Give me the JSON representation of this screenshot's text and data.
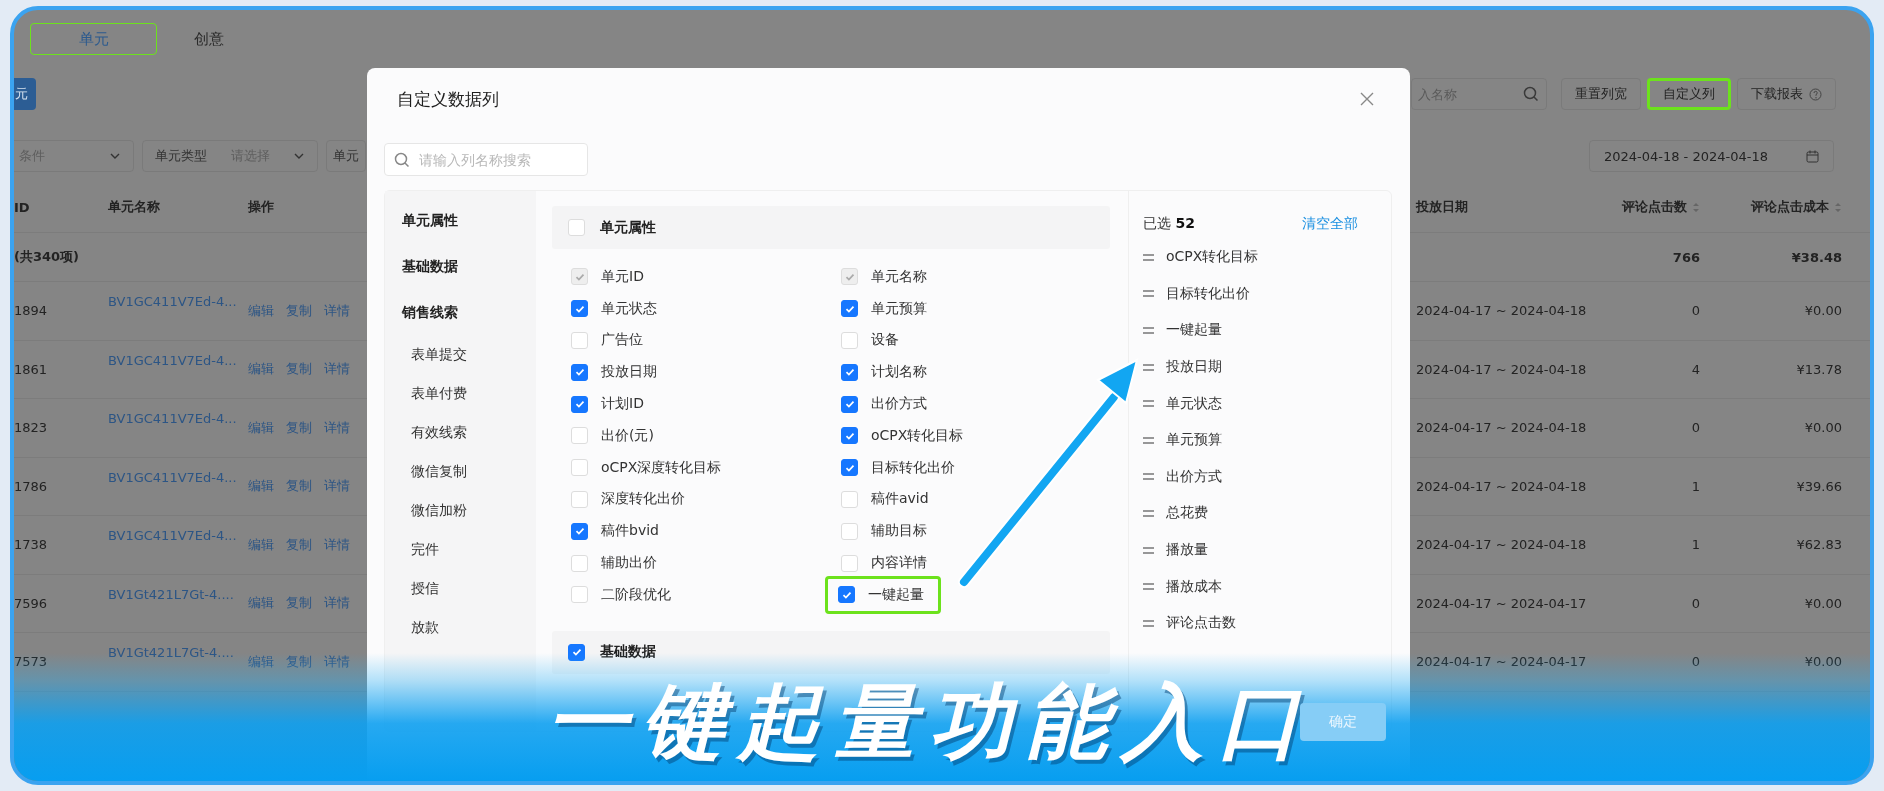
{
  "tabs": [
    {
      "label": "单元",
      "selected": true,
      "highlighted": true
    },
    {
      "label": "创意",
      "selected": false,
      "highlighted": false
    }
  ],
  "create_button": {
    "label": "元"
  },
  "search": {
    "placeholder": "入名称"
  },
  "toolbar_buttons": [
    {
      "label": "重置列宽",
      "kind": "plain",
      "highlighted": false
    },
    {
      "label": "自定义列",
      "kind": "plain",
      "highlighted": true
    },
    {
      "label": "下载报表",
      "kind": "help",
      "highlighted": false
    }
  ],
  "filters": [
    {
      "placeholder": "条件"
    },
    {
      "label": "单元类型",
      "placeholder": "请选择"
    },
    {
      "label": "单元"
    }
  ],
  "date_range": {
    "value": "2024-04-18 - 2024-04-18"
  },
  "table": {
    "columns": [
      {
        "label": "ID",
        "sortable": false
      },
      {
        "label": "单元名称",
        "sortable": false
      },
      {
        "label": "操作",
        "sortable": false
      },
      {
        "label": "投放日期",
        "sortable": false
      },
      {
        "label": "评论点击数",
        "sortable": true
      },
      {
        "label": "评论点击成本",
        "sortable": true
      }
    ],
    "summary": {
      "label": "(共340项)",
      "comment_clicks": "766",
      "comment_click_cost": "¥38.48"
    },
    "rows": [
      {
        "id": "1894",
        "name": "BV1GC411V7Ed-4...",
        "actions": [
          "编辑",
          "复制",
          "详情"
        ],
        "dates": "2024-04-17 ~ 2024-04-18",
        "comment_clicks": "0",
        "comment_click_cost": "¥0.00"
      },
      {
        "id": "1861",
        "name": "BV1GC411V7Ed-4...",
        "actions": [
          "编辑",
          "复制",
          "详情"
        ],
        "dates": "2024-04-17 ~ 2024-04-18",
        "comment_clicks": "4",
        "comment_click_cost": "¥13.78"
      },
      {
        "id": "1823",
        "name": "BV1GC411V7Ed-4...",
        "actions": [
          "编辑",
          "复制",
          "详情"
        ],
        "dates": "2024-04-17 ~ 2024-04-18",
        "comment_clicks": "0",
        "comment_click_cost": "¥0.00"
      },
      {
        "id": "1786",
        "name": "BV1GC411V7Ed-4...",
        "actions": [
          "编辑",
          "复制",
          "详情"
        ],
        "dates": "2024-04-17 ~ 2024-04-18",
        "comment_clicks": "1",
        "comment_click_cost": "¥39.66"
      },
      {
        "id": "1738",
        "name": "BV1GC411V7Ed-4...",
        "actions": [
          "编辑",
          "复制",
          "详情"
        ],
        "dates": "2024-04-17 ~ 2024-04-18",
        "comment_clicks": "1",
        "comment_click_cost": "¥62.83"
      },
      {
        "id": "7596",
        "name": "BV1Gt421L7Gt-4....",
        "actions": [
          "编辑",
          "复制",
          "详情"
        ],
        "dates": "2024-04-17 ~ 2024-04-17",
        "comment_clicks": "0",
        "comment_click_cost": "¥0.00"
      },
      {
        "id": "7573",
        "name": "BV1Gt421L7Gt-4....",
        "actions": [
          "编辑",
          "复制",
          "详情"
        ],
        "dates": "2024-04-17 ~ 2024-04-17",
        "comment_clicks": "0",
        "comment_click_cost": "¥0.00"
      }
    ]
  },
  "modal": {
    "title": "自定义数据列",
    "search_placeholder": "请输入列名称搜索",
    "nav": [
      {
        "label": "单元属性"
      },
      {
        "label": "基础数据"
      },
      {
        "label": "销售线索",
        "children": [
          {
            "label": "表单提交"
          },
          {
            "label": "表单付费"
          },
          {
            "label": "有效线索"
          },
          {
            "label": "微信复制"
          },
          {
            "label": "微信加粉"
          },
          {
            "label": "完件"
          },
          {
            "label": "授信"
          },
          {
            "label": "放款"
          }
        ]
      }
    ],
    "group": {
      "label": "单元属性",
      "checked": false
    },
    "options": [
      {
        "label": "单元ID",
        "checked": true,
        "disabled": true,
        "highlighted": false
      },
      {
        "label": "单元名称",
        "checked": true,
        "disabled": true,
        "highlighted": false
      },
      {
        "label": "单元状态",
        "checked": true,
        "disabled": false,
        "highlighted": false
      },
      {
        "label": "单元预算",
        "checked": true,
        "disabled": false,
        "highlighted": false
      },
      {
        "label": "广告位",
        "checked": false,
        "disabled": false,
        "highlighted": false
      },
      {
        "label": "设备",
        "checked": false,
        "disabled": false,
        "highlighted": false
      },
      {
        "label": "投放日期",
        "checked": true,
        "disabled": false,
        "highlighted": false
      },
      {
        "label": "计划名称",
        "checked": true,
        "disabled": false,
        "highlighted": false
      },
      {
        "label": "计划ID",
        "checked": true,
        "disabled": false,
        "highlighted": false
      },
      {
        "label": "出价方式",
        "checked": true,
        "disabled": false,
        "highlighted": false
      },
      {
        "label": "出价(元)",
        "checked": false,
        "disabled": false,
        "highlighted": false
      },
      {
        "label": "oCPX转化目标",
        "checked": true,
        "disabled": false,
        "highlighted": false
      },
      {
        "label": "oCPX深度转化目标",
        "checked": false,
        "disabled": false,
        "highlighted": false
      },
      {
        "label": "目标转化出价",
        "checked": true,
        "disabled": false,
        "highlighted": false
      },
      {
        "label": "深度转化出价",
        "checked": false,
        "disabled": false,
        "highlighted": false
      },
      {
        "label": "稿件avid",
        "checked": false,
        "disabled": false,
        "highlighted": false
      },
      {
        "label": "稿件bvid",
        "checked": true,
        "disabled": false,
        "highlighted": false
      },
      {
        "label": "辅助目标",
        "checked": false,
        "disabled": false,
        "highlighted": false
      },
      {
        "label": "辅助出价",
        "checked": false,
        "disabled": false,
        "highlighted": false
      },
      {
        "label": "内容详情",
        "checked": false,
        "disabled": false,
        "highlighted": false
      },
      {
        "label": "二阶段优化",
        "checked": false,
        "disabled": false,
        "highlighted": false
      },
      {
        "label": "一键起量",
        "checked": true,
        "disabled": false,
        "highlighted": true
      }
    ],
    "next_group": {
      "label": "基础数据",
      "checked": true
    },
    "selected_panel": {
      "label": "已选",
      "count": "52",
      "clear": "清空全部",
      "items": [
        "oCPX转化目标",
        "目标转化出价",
        "一键起量",
        "投放日期",
        "单元状态",
        "单元预算",
        "出价方式",
        "总花费",
        "播放量",
        "播放成本",
        "评论点击数"
      ]
    },
    "confirm": "确定"
  },
  "caption": "一键起量功能入口"
}
